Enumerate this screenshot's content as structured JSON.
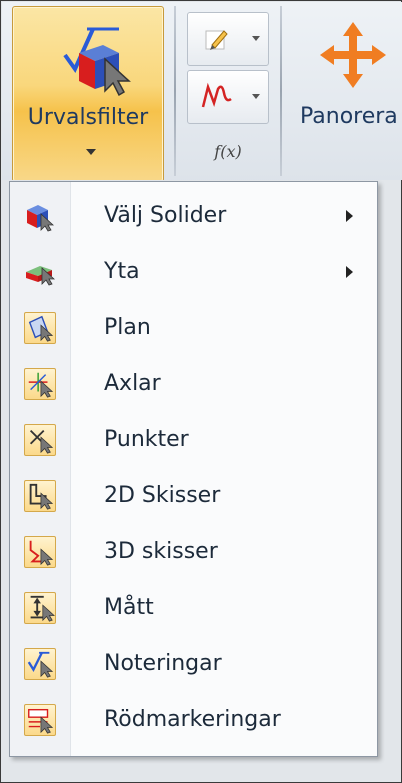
{
  "ribbon": {
    "selection_filter": {
      "label": "Urvalsfilter",
      "icon": "selection-filter-icon"
    },
    "sketch_button": {
      "icon": "pencil-sketch-icon"
    },
    "function_button": {
      "icon": "function-curve-icon"
    },
    "function_group_label": "f(x)",
    "pan": {
      "label": "Panorera",
      "icon": "pan-move-icon"
    }
  },
  "menu": {
    "items": [
      {
        "label": "Välj Solider",
        "icon": "solid-select-icon",
        "has_submenu": true
      },
      {
        "label": "Yta",
        "icon": "surface-select-icon",
        "has_submenu": true
      },
      {
        "label": "Plan",
        "icon": "plane-icon",
        "has_submenu": false
      },
      {
        "label": "Axlar",
        "icon": "axis-icon",
        "has_submenu": false
      },
      {
        "label": "Punkter",
        "icon": "point-icon",
        "has_submenu": false
      },
      {
        "label": "2D Skisser",
        "icon": "2d-sketch-icon",
        "has_submenu": false
      },
      {
        "label": "3D skisser",
        "icon": "3d-sketch-icon",
        "has_submenu": false
      },
      {
        "label": "Mått",
        "icon": "dimension-icon",
        "has_submenu": false
      },
      {
        "label": "Noteringar",
        "icon": "annotation-icon",
        "has_submenu": false
      },
      {
        "label": "Rödmarkeringar",
        "icon": "markup-icon",
        "has_submenu": false
      }
    ]
  },
  "colors": {
    "accent": "#f6c24b",
    "pan_orange": "#f07d22",
    "text": "#1c2a3a"
  }
}
